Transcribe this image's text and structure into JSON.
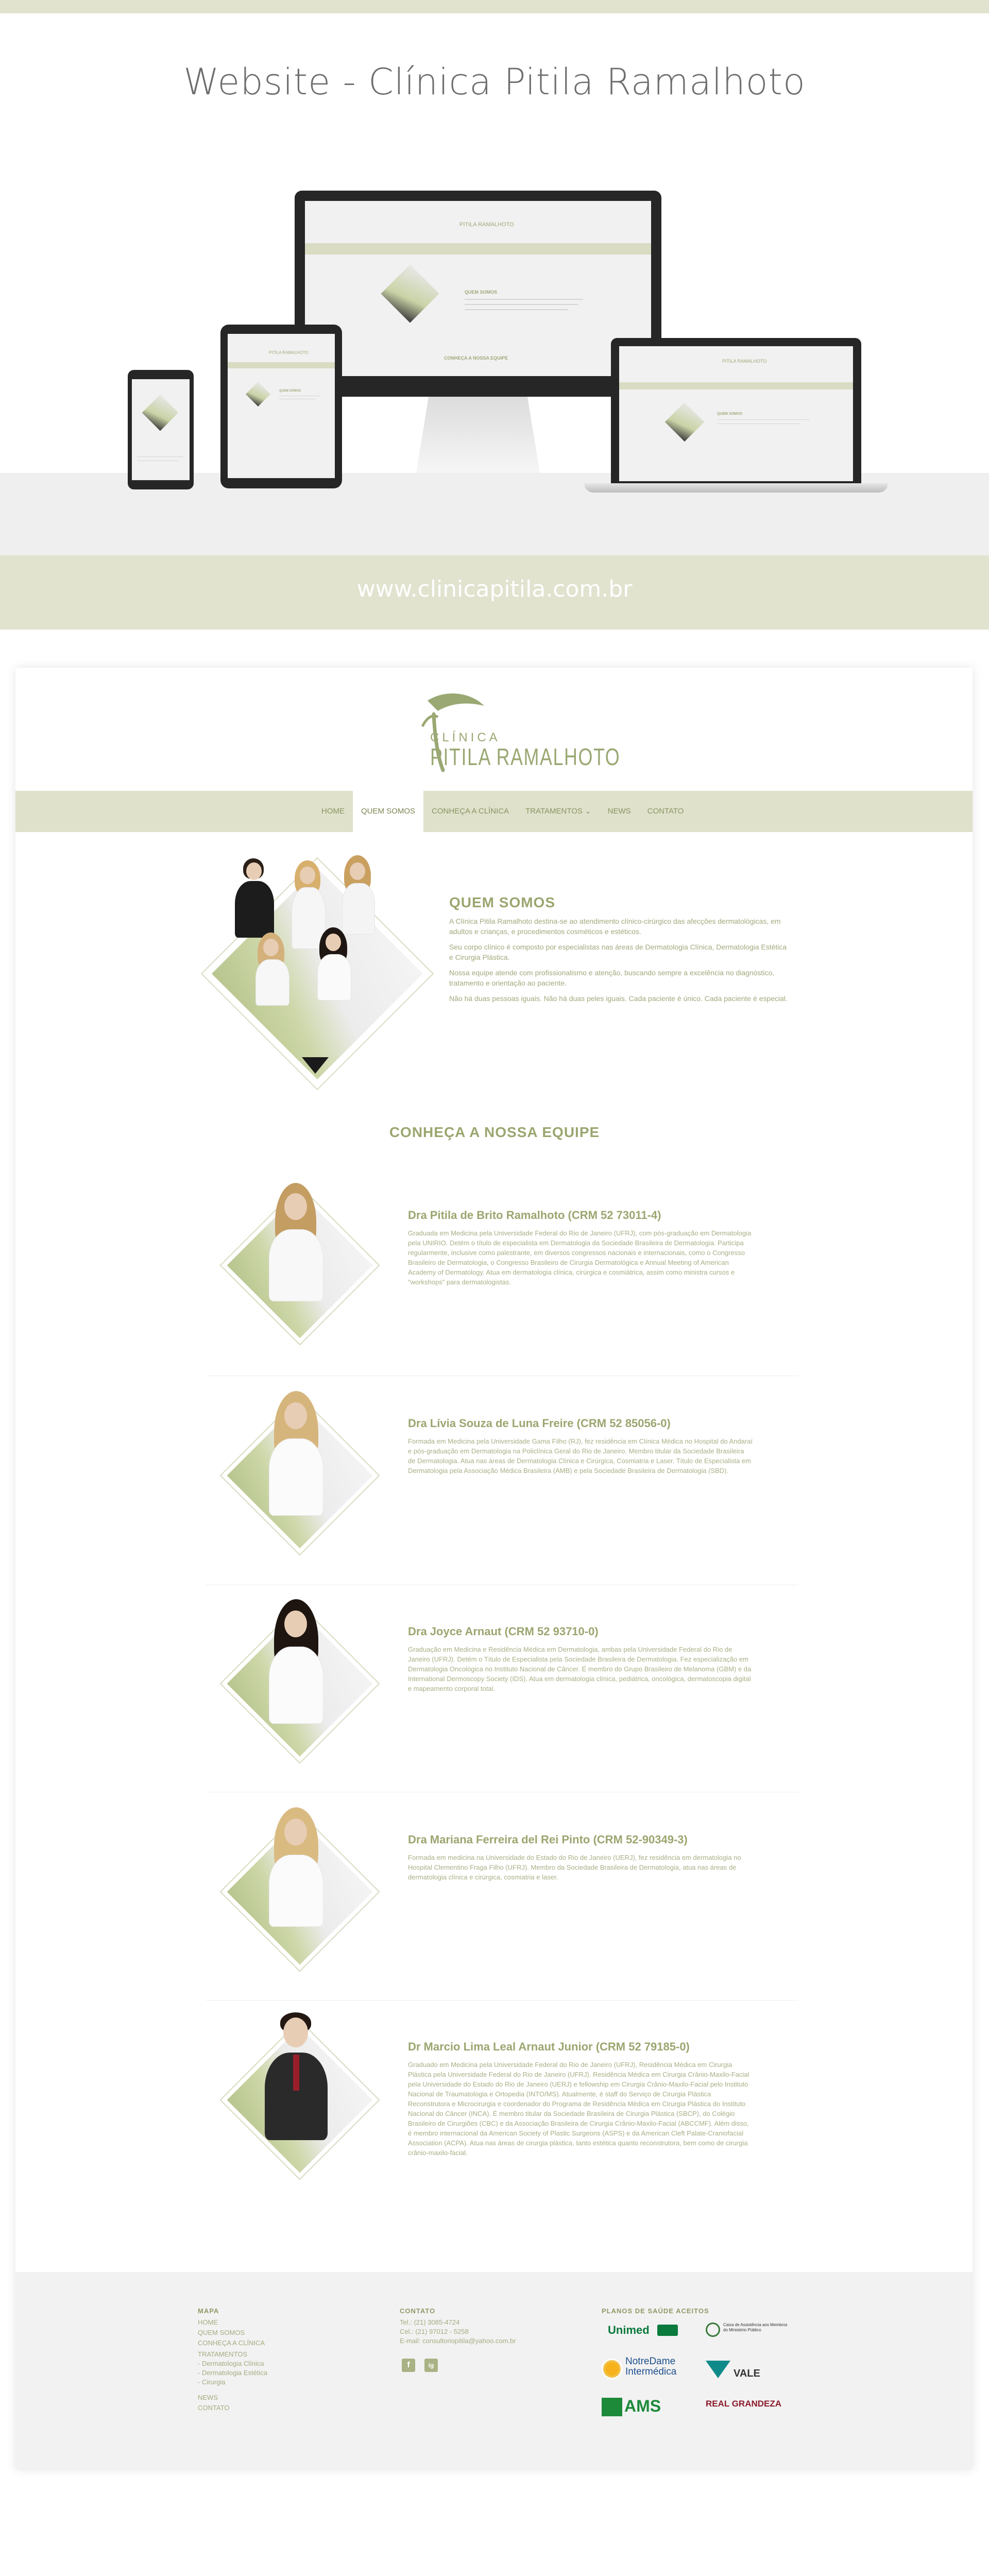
{
  "presentation": {
    "title": "Website - Clínica Pitila Ramalhoto",
    "url": "www.clinicapitila.com.br"
  },
  "mockups": {
    "logo_line1": "CLÍNICA",
    "logo_line2": "PITILA RAMALHOTO",
    "section_label": "QUEM SOMOS",
    "team_label": "CONHEÇA A NOSSA EQUIPE"
  },
  "site": {
    "logo": {
      "line1": "CLÍNICA",
      "line2": "PITILA RAMALHOTO"
    },
    "nav": [
      "HOME",
      "QUEM SOMOS",
      "CONHEÇA A CLÍNICA",
      "TRATAMENTOS ⌄",
      "NEWS",
      "CONTATO"
    ],
    "nav_active": "QUEM SOMOS",
    "about": {
      "title": "QUEM SOMOS",
      "paragraphs": [
        "A Clínica Pitila Ramalhoto destina-se ao atendimento clínico-cirúrgico das afecções dermatológicas, em adultos e crianças, e procedimentos cosméticos e estéticos.",
        "Seu corpo clínico é composto por especialistas nas áreas de Dermatologia Clínica, Dermatologia Estética e Cirurgia Plástica.",
        "Nossa equipe atende com profissionalismo e atenção, buscando sempre a excelência no diagnóstico, tratamento e orientação ao paciente.",
        "Não há duas pessoas iguais. Não há duas peles iguais. Cada paciente é único. Cada paciente é especial."
      ]
    },
    "team_title": "CONHEÇA A NOSSA EQUIPE",
    "team": [
      {
        "name": "Dra Pitila de Brito Ramalhoto (CRM 52 73011-4)",
        "bio": "Graduada em Medicina pela Universidade Federal do Rio de Janeiro (UFRJ), com pós-graduação em Dermatologia pela UNIRIO. Detém o título de especialista em Dermatologia da Sociedade Brasileira de Dermatologia. Participa regularmente, inclusive como palestrante, em diversos congressos nacionais e internacionais, como o Congresso Brasileiro de Dermatologia, o Congresso Brasileiro de Cirurgia Dermatológica e Annual Meeting of American Academy of Dermatology. Atua em dermatologia clínica, cirúrgica e cosmiátrica, assim como ministra cursos e \"workshops\" para dermatologistas."
      },
      {
        "name": "Dra Lívia Souza de Luna Freire (CRM 52 85056-0)",
        "bio": "Formada em Medicina pela Universidade Gama Filho (RJ), fez residência em Clínica Médica no Hospital do Andaraí e pós-graduação em Dermatologia na Policlínica Geral do Rio de Janeiro. Membro titular da Sociedade Brasileira de Dermatologia. Atua nas áreas de Dermatologia Clínica e Cirúrgica, Cosmiatria e Laser. Título de Especialista em Dermatologia pela Associação Médica Brasileira (AMB) e pela Sociedade Brasileira de Dermatologia (SBD)."
      },
      {
        "name": "Dra Joyce Arnaut (CRM 52 93710-0)",
        "bio": "Graduação em Medicina e Residência Médica em Dermatologia, ambas pela Universidade Federal do Rio de Janeiro (UFRJ). Detém o Título de Especialista pela Sociedade Brasileira de Dermatologia. Fez especialização em Dermatologia Oncológica no Instituto Nacional de Câncer. É membro do Grupo Brasileiro de Melanoma (GBM) e da International Dermoscopy Society (IDS). Atua em dermatologia clínica, pediátrica, oncológica, dermatoscopia digital e mapeamento corporal total."
      },
      {
        "name": "Dra Mariana Ferreira del Rei Pinto (CRM 52-90349-3)",
        "bio": "Formada em medicina na Universidade do Estado do Rio de Janeiro (UERJ), fez residência em dermatologia no Hospital Clementino Fraga Filho (UFRJ). Membro da Sociedade Brasileira de Dermatologia, atua nas áreas de dermatologia clínica e cirúrgica, cosmiatria e laser."
      },
      {
        "name": "Dr Marcio Lima Leal Arnaut Junior (CRM 52 79185-0)",
        "bio": "Graduado em Medicina pela Universidade Federal do Rio de Janeiro (UFRJ), Residência Médica em Cirurgia Plástica pela Universidade Federal do Rio de Janeiro (UFRJ). Residência Médica em Cirurgia Crânio-Maxilo-Facial pela Universidade do Estado do Rio de Janeiro (UERJ) e fellowship em Cirurgia Crânio-Maxilo-Facial pelo Instituto Nacional de Traumatologia e Ortopedia (INTO/MS). Atualmente, é staff do Serviço de Cirurgia Plástica Reconstrutora e Microcirurgia e coordenador do Programa de Residência Médica em Cirurgia Plástica do Instituto Nacional do Câncer (INCA). É membro titular da Sociedade Brasileira de Cirurgia Plástica (SBCP), do Colégio Brasileiro de Cirurgiões (CBC) e da Associação Brasileira de Cirurgia Crânio-Maxilo-Facial (ABCCMF). Além disso, é membro internacional da American Society of Plastic Surgeons (ASPS) e da American Cleft Palate-Craniofacial Association (ACPA). Atua nas áreas de cirurgia plástica, tanto estética quanto reconstrutora, bem como de cirurgia crânio-maxilo-facial."
      }
    ],
    "footer": {
      "mapa_title": "MAPA",
      "mapa_links": [
        "HOME",
        "QUEM SOMOS",
        "CONHEÇA A CLÍNICA",
        "TRATAMENTOS",
        "- Dermatologia Clínica",
        "- Dermatologia Estética",
        "- Cirurgia",
        "NEWS",
        "CONTATO"
      ],
      "contato_title": "CONTATO",
      "contato_lines": [
        "Tel.: (21) 3085-4724",
        "Cel.: (21) 97012 - 5258",
        "E-mail: consultoriopitila@yahoo.com.br"
      ],
      "planos_title": "PLANOS DE SAÚDE ACEITOS",
      "planos": [
        "Unimed",
        "Caixa de Assistência aos Membros do Ministério Público",
        "NotreDame Intermédica",
        "VALE",
        "AMS",
        "REAL GRANDEZA"
      ],
      "social": [
        "f",
        "ig"
      ]
    }
  },
  "colors": {
    "accent": "#9aa66f",
    "band": "#e1e3cf",
    "nav": "#dfe1cb"
  }
}
